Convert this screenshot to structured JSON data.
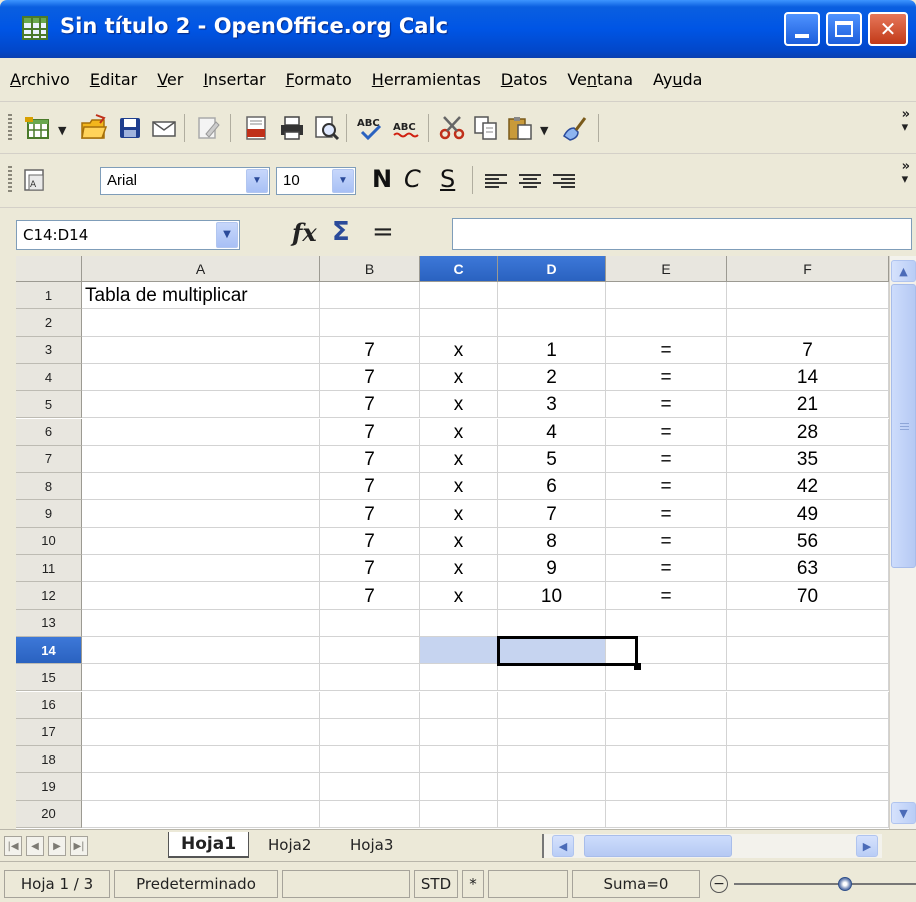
{
  "window": {
    "title": "Sin título 2 - OpenOffice.org Calc"
  },
  "menu": [
    {
      "label": "Archivo",
      "mn": "A",
      "rest": "rchivo"
    },
    {
      "label": "Editar",
      "mn": "E",
      "rest": "ditar"
    },
    {
      "label": "Ver",
      "mn": "V",
      "rest": "er"
    },
    {
      "label": "Insertar",
      "mn": "I",
      "rest": "nsertar"
    },
    {
      "label": "Formato",
      "mn": "F",
      "rest": "ormato"
    },
    {
      "label": "Herramientas",
      "mn": "H",
      "rest": "erramientas"
    },
    {
      "label": "Datos",
      "mn": "D",
      "rest": "atos"
    },
    {
      "label": "Ventana",
      "pre": "Ve",
      "mn": "n",
      "rest": "tana"
    },
    {
      "label": "Ayuda",
      "pre": "Ay",
      "mn": "u",
      "rest": "da"
    }
  ],
  "format_toolbar": {
    "font_name": "Arial",
    "font_size": "10",
    "bold_label": "N",
    "italic_label": "C",
    "underline_label": "S"
  },
  "formula_bar": {
    "name_box": "C14:D14",
    "function_glyph": "fx",
    "sum_glyph": "Σ",
    "equals_glyph": "=",
    "formula_value": ""
  },
  "sheet": {
    "columns": [
      "A",
      "B",
      "C",
      "D",
      "E",
      "F"
    ],
    "selected_columns": [
      "C",
      "D"
    ],
    "rows": [
      "1",
      "2",
      "3",
      "4",
      "5",
      "6",
      "7",
      "8",
      "9",
      "10",
      "11",
      "12",
      "13",
      "14",
      "15",
      "16",
      "17",
      "18",
      "19",
      "20"
    ],
    "selected_row": "14",
    "title_cell": "Tabla de multiplicar",
    "table": [
      [
        "7",
        "x",
        "1",
        "=",
        "7"
      ],
      [
        "7",
        "x",
        "2",
        "=",
        "14"
      ],
      [
        "7",
        "x",
        "3",
        "=",
        "21"
      ],
      [
        "7",
        "x",
        "4",
        "=",
        "28"
      ],
      [
        "7",
        "x",
        "5",
        "=",
        "35"
      ],
      [
        "7",
        "x",
        "6",
        "=",
        "42"
      ],
      [
        "7",
        "x",
        "7",
        "=",
        "49"
      ],
      [
        "7",
        "x",
        "8",
        "=",
        "56"
      ],
      [
        "7",
        "x",
        "9",
        "=",
        "63"
      ],
      [
        "7",
        "x",
        "10",
        "=",
        "70"
      ]
    ]
  },
  "tabs": {
    "sheets": [
      "Hoja1",
      "Hoja2",
      "Hoja3"
    ],
    "active": "Hoja1"
  },
  "status": {
    "page": "Hoja 1 / 3",
    "style": "Predeterminado",
    "mode": "STD",
    "modified": "*",
    "sum": "Suma=0"
  },
  "colors": {
    "selection": "#c6d4f0",
    "header_selected": "#2a62c0",
    "titlebar": "#0055e5"
  }
}
